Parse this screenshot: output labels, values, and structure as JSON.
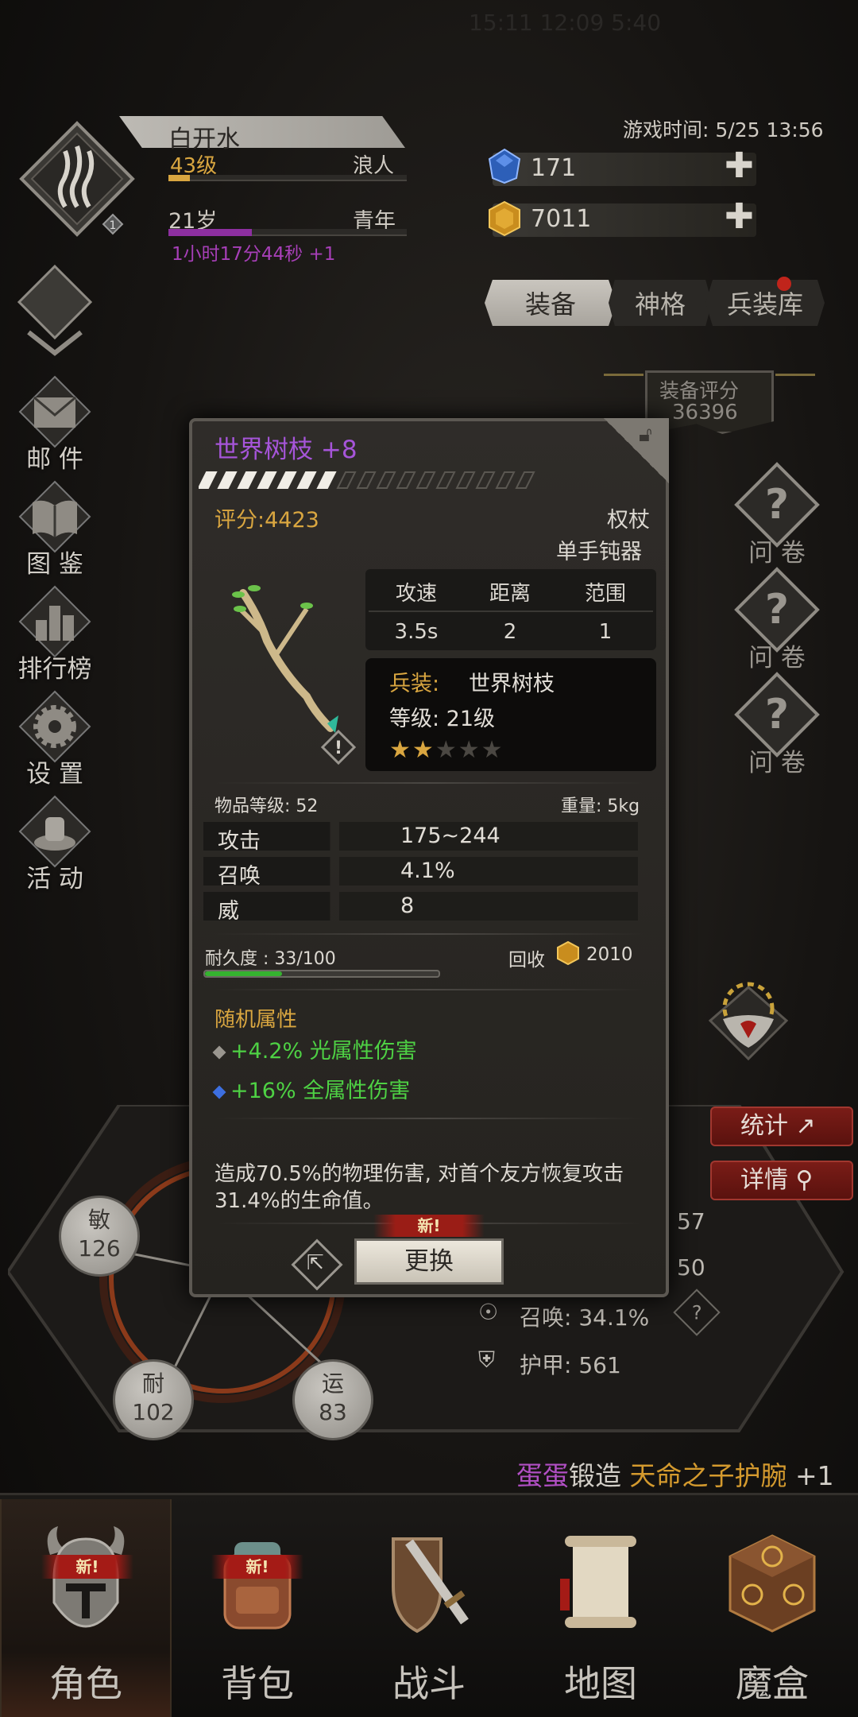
{
  "status_bar": {
    "time": "15:11 12:09 5:40"
  },
  "player": {
    "name": "白开水",
    "level": "43级",
    "class": "浪人",
    "age": "21岁",
    "age_stage": "青年",
    "age_timer": "1小时17分44秒 +1",
    "badge": "1",
    "xp_fraction": 0.09,
    "age_fraction": 0.35
  },
  "game_time": "游戏时间: 5/25 13:56",
  "currency": {
    "gems": "171",
    "gold": "7011",
    "plus": "✚"
  },
  "tabs": {
    "equip": "装备",
    "rune": "神格",
    "armory": "兵装库"
  },
  "equip_score": {
    "label": "装备评分",
    "value": "36396"
  },
  "left_menu": {
    "mail": "邮 件",
    "atlas": "图 鉴",
    "rank": "排行榜",
    "settings": "设 置",
    "event": "活 动"
  },
  "right_menu": {
    "q1": "问 卷",
    "q2": "问 卷",
    "q3": "问 卷"
  },
  "item": {
    "name": "世界树枝 +8",
    "enhance_fraction": 0.4,
    "score": "评分:4423",
    "type": "权杖",
    "slot": "单手钝器",
    "spec_headers": [
      "攻速",
      "距离",
      "范围"
    ],
    "spec_values": [
      "3.5s",
      "2",
      "1"
    ],
    "weapon_label": "兵装:",
    "weapon_name": "世界树枝",
    "weapon_level": "等级:  21级",
    "stars_on": 2,
    "stars_total": 5,
    "item_level": "物品等级: 52",
    "weight": "重量:  5kg",
    "attrs": [
      {
        "k": "攻击",
        "v": "175~244"
      },
      {
        "k": "召唤",
        "v": "4.1%"
      },
      {
        "k": "威",
        "v": "8"
      }
    ],
    "durability": "耐久度 : 33/100",
    "durability_fraction": 0.33,
    "recycle_label": "回收",
    "recycle_value": "2010",
    "random_title": "随机属性",
    "random_attrs": [
      {
        "text": "+4.2% 光属性伤害",
        "color": "#9a968f"
      },
      {
        "text": "+16%  全属性伤害",
        "color": "#3d6fe0"
      }
    ],
    "description": "造成70.5%的物理伤害, 对首个友方恢复攻击31.4%的生命值。",
    "new_tag": "新!",
    "replace_label": "更换"
  },
  "stats": {
    "agi": {
      "k": "敏",
      "v": "126"
    },
    "end": {
      "k": "耐",
      "v": "102"
    },
    "luck": {
      "k": "运",
      "v": "83"
    },
    "v57": "57",
    "v50": "50",
    "summon": "召唤: 34.1%",
    "armor": "护甲: 561",
    "btn_stats": "统计",
    "btn_detail": "详情"
  },
  "ticker": {
    "p1": "蛋蛋",
    "w1": "锻造 ",
    "o1": "天命之子护腕",
    "w2": " +1"
  },
  "nav": {
    "role": "角色",
    "bag": "背包",
    "battle": "战斗",
    "map": "地图",
    "box": "魔盒",
    "badge": "新!"
  },
  "colors": {
    "accent_gold": "#d9a640",
    "item_purple": "#a655d9",
    "green": "#4ed144",
    "red": "#a41b16"
  }
}
